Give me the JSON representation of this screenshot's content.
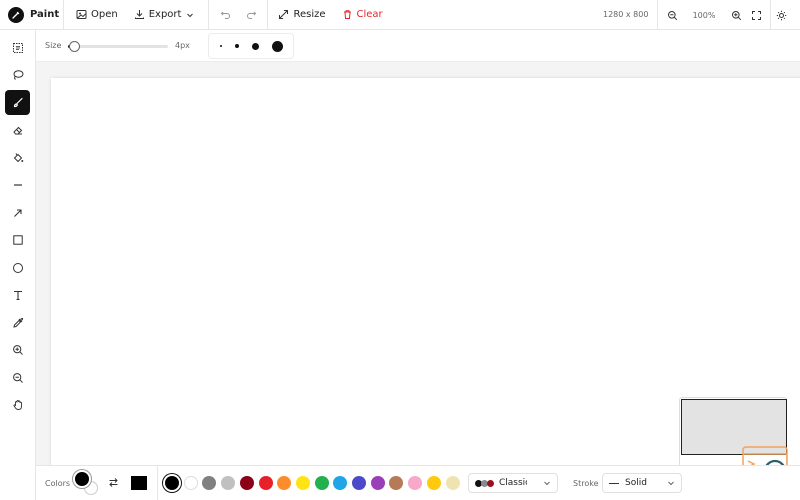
{
  "app": {
    "name": "Paint"
  },
  "toolbar": {
    "open_label": "Open",
    "export_label": "Export",
    "resize_label": "Resize",
    "clear_label": "Clear",
    "canvas_dims": "1280 x 800",
    "zoom_level": "100%"
  },
  "tools": [
    {
      "name": "select-tool",
      "icon": "select-icon",
      "active": false
    },
    {
      "name": "lasso-tool",
      "icon": "lasso-icon",
      "active": false
    },
    {
      "name": "brush-tool",
      "icon": "brush-icon",
      "active": true
    },
    {
      "name": "eraser-tool",
      "icon": "eraser-icon",
      "active": false
    },
    {
      "name": "fill-tool",
      "icon": "paint-bucket-icon",
      "active": false
    },
    {
      "name": "line-tool",
      "icon": "line-icon",
      "active": false
    },
    {
      "name": "arrow-tool",
      "icon": "arrow-icon",
      "active": false
    },
    {
      "name": "rectangle-tool",
      "icon": "rectangle-icon",
      "active": false
    },
    {
      "name": "ellipse-tool",
      "icon": "ellipse-icon",
      "active": false
    },
    {
      "name": "text-tool",
      "icon": "text-icon",
      "active": false
    },
    {
      "name": "eyedropper-tool",
      "icon": "eyedropper-icon",
      "active": false
    },
    {
      "name": "zoom-in-tool",
      "icon": "zoom-in-icon",
      "active": false
    },
    {
      "name": "zoom-out-tool",
      "icon": "zoom-out-icon",
      "active": false
    },
    {
      "name": "pan-tool",
      "icon": "hand-icon",
      "active": false
    }
  ],
  "options": {
    "size_label": "Size",
    "size_value": "4px",
    "size_fraction": 0.04
  },
  "colors": {
    "label": "Colors",
    "primary": "#000000",
    "secondary": "#ffffff",
    "palette": [
      "#000000",
      "#ffffff",
      "#808080",
      "#c0c0c0",
      "#8b0016",
      "#e8202a",
      "#ff8c2a",
      "#ffe414",
      "#22b14c",
      "#1fa6e8",
      "#4a4acb",
      "#9b3fb8",
      "#b57a56",
      "#f8a8c8",
      "#ffc90e",
      "#efe4b0"
    ],
    "selected_index": 0,
    "palette_name": "Classic",
    "palette_preview": [
      "#111111",
      "#8a8a8a",
      "#9b1020"
    ]
  },
  "stroke": {
    "label": "Stroke",
    "value": "Solid"
  },
  "accent": {
    "danger": "#e0262b",
    "active_tool": "#111111"
  }
}
